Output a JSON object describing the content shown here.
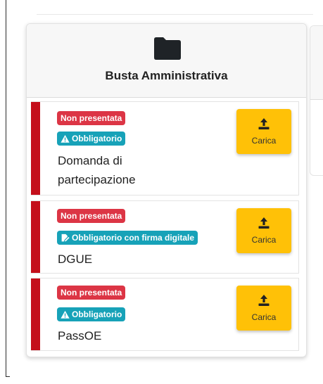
{
  "section": {
    "title": "Busta Amministrativa",
    "icon": "folder-icon"
  },
  "documents": [
    {
      "status": "Non presentata",
      "requirement": "Obbligatorio",
      "requirement_icon": "warning-icon",
      "name": "Domanda di partecipazione",
      "action_label": "Carica",
      "action_icon": "upload-icon"
    },
    {
      "status": "Non presentata",
      "requirement": "Obbligatorio con firma digitale",
      "requirement_icon": "signature-icon",
      "name": "DGUE",
      "action_label": "Carica",
      "action_icon": "upload-icon"
    },
    {
      "status": "Non presentata",
      "requirement": "Obbligatorio",
      "requirement_icon": "warning-icon",
      "name": "PassOE",
      "action_label": "Carica",
      "action_icon": "upload-icon"
    }
  ],
  "colors": {
    "status_badge": "#dc3545",
    "requirement_badge": "#17a2b8",
    "upload_button": "#ffc107",
    "stripe": "#c40f1b"
  }
}
